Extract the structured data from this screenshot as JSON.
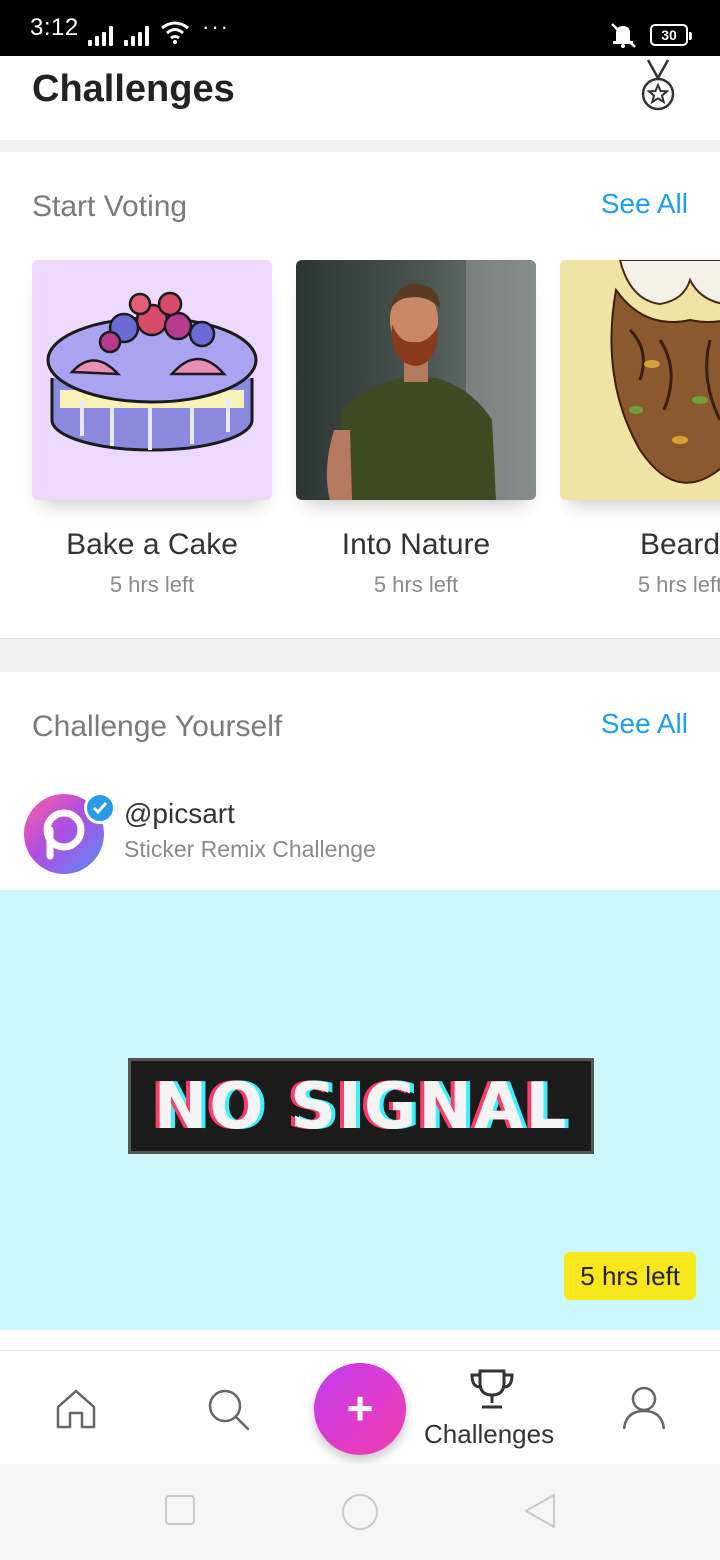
{
  "status_bar": {
    "time": "3:12",
    "dots": "···",
    "battery": "30"
  },
  "header": {
    "title": "Challenges",
    "medal_icon": "medal-icon"
  },
  "voting": {
    "title": "Start Voting",
    "see_all": "See All",
    "cards": [
      {
        "name": "Bake a Cake",
        "time_left": "5 hrs left"
      },
      {
        "name": "Into Nature",
        "time_left": "5 hrs left"
      },
      {
        "name": "Beard",
        "time_left": "5 hrs left"
      }
    ]
  },
  "yourself": {
    "title": "Challenge Yourself",
    "see_all": "See All",
    "creator": {
      "handle": "@picsart",
      "challenge": "Sticker Remix Challenge"
    },
    "banner": {
      "text": "NO SIGNAL",
      "time_left": "5 hrs left",
      "background": "#ccf7fb"
    }
  },
  "bottom_nav": {
    "items": [
      "home-icon",
      "search-icon",
      "add-button",
      "trophy-icon",
      "profile-icon"
    ],
    "add_symbol": "+",
    "active_label": "Challenges",
    "fab_color": "#d23ce0"
  },
  "colors": {
    "accent": "#1f9ee8",
    "badge": "#f8e71c"
  }
}
